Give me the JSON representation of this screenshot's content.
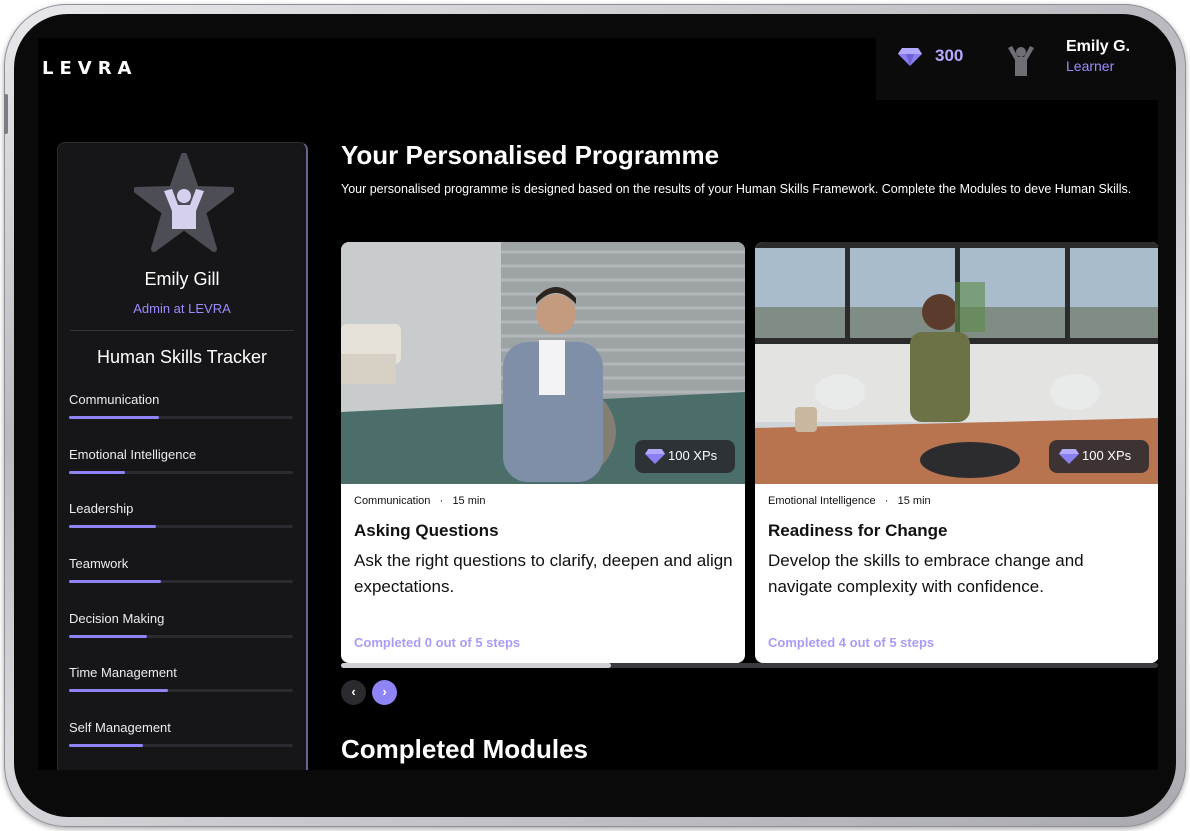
{
  "brand": {
    "logo_text": "LEVRA"
  },
  "header": {
    "xp_total": "300",
    "user_name": "Emily G.",
    "user_role": "Learner",
    "gem_icon": "diamond-icon",
    "avatar_icon": "user-cheer-icon"
  },
  "sidebar": {
    "profile_name": "Emily Gill",
    "profile_role": "Admin at LEVRA",
    "tracker_title": "Human Skills Tracker",
    "skills": [
      {
        "label": "Communication",
        "progress": 0.4
      },
      {
        "label": "Emotional Intelligence",
        "progress": 0.25
      },
      {
        "label": "Leadership",
        "progress": 0.39
      },
      {
        "label": "Teamwork",
        "progress": 0.41
      },
      {
        "label": "Decision Making",
        "progress": 0.35
      },
      {
        "label": "Time Management",
        "progress": 0.44
      },
      {
        "label": "Self Management",
        "progress": 0.33
      }
    ]
  },
  "main": {
    "title": "Your Personalised Programme",
    "description": "Your personalised programme is designed based on the results of your Human Skills Framework. Complete the Modules to deve Human Skills.",
    "cards": [
      {
        "category": "Communication",
        "duration": "15 min",
        "xp": "100 XPs",
        "title": "Asking Questions",
        "description": "Ask the right questions to clarify, deepen and align expectations.",
        "progress_text": "Completed 0 out of 5 steps"
      },
      {
        "category": "Emotional Intelligence",
        "duration": "15 min",
        "xp": "100 XPs",
        "title": "Readiness for Change",
        "description": "Develop the skills to embrace change and navigate complexity with confidence.",
        "progress_text": "Completed 4 out of 5 steps"
      }
    ],
    "carousel_scroll_position": 0.33,
    "nav_prev": "‹",
    "nav_next": "›",
    "completed_title": "Completed Modules"
  },
  "colors": {
    "accent": "#8f84f5",
    "accent_text": "#9a8cff",
    "background": "#000000",
    "card": "#ffffff"
  }
}
